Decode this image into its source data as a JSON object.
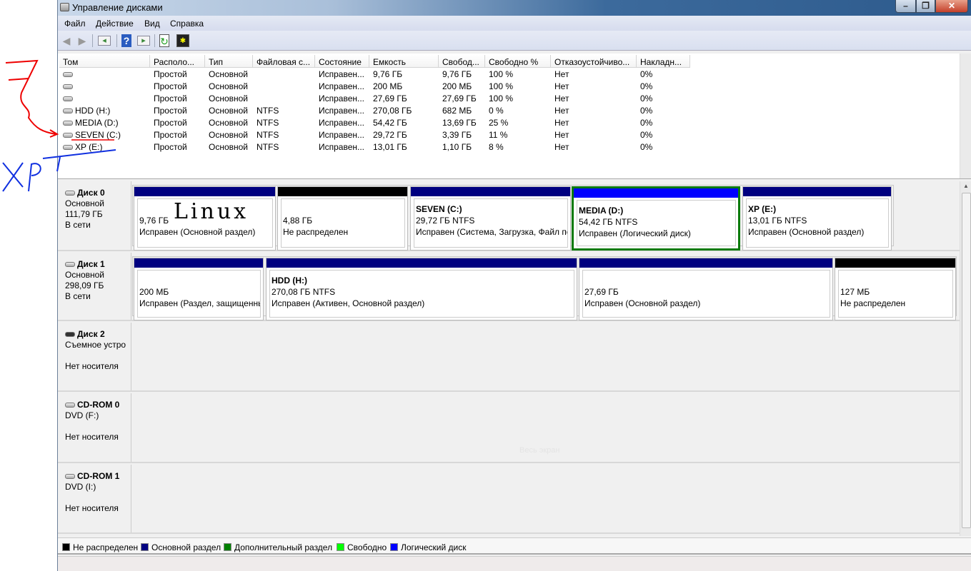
{
  "window": {
    "title": "Управление дисками",
    "minimize": "–",
    "maximize": "❐",
    "close": "✕"
  },
  "menu": [
    "Файл",
    "Действие",
    "Вид",
    "Справка"
  ],
  "toolbar": {
    "icons": [
      "back-arrow-icon",
      "forward-arrow-icon",
      "console-tree-icon",
      "help-icon",
      "action-pane-icon",
      "refresh-icon",
      "properties-icon"
    ]
  },
  "volume_list": {
    "columns": [
      "Том",
      "Располо...",
      "Тип",
      "Файловая с...",
      "Состояние",
      "Емкость",
      "Свобод...",
      "Свободно %",
      "Отказоустойчиво...",
      "Накладн..."
    ],
    "rows": [
      [
        "",
        "Простой",
        "Основной",
        "",
        "Исправен...",
        "9,76 ГБ",
        "9,76 ГБ",
        "100 %",
        "Нет",
        "0%"
      ],
      [
        "",
        "Простой",
        "Основной",
        "",
        "Исправен...",
        "200 МБ",
        "200 МБ",
        "100 %",
        "Нет",
        "0%"
      ],
      [
        "",
        "Простой",
        "Основной",
        "",
        "Исправен...",
        "27,69 ГБ",
        "27,69 ГБ",
        "100 %",
        "Нет",
        "0%"
      ],
      [
        "HDD (H:)",
        "Простой",
        "Основной",
        "NTFS",
        "Исправен...",
        "270,08 ГБ",
        "682 МБ",
        "0 %",
        "Нет",
        "0%"
      ],
      [
        "MEDIA (D:)",
        "Простой",
        "Основной",
        "NTFS",
        "Исправен...",
        "54,42 ГБ",
        "13,69 ГБ",
        "25 %",
        "Нет",
        "0%"
      ],
      [
        "SEVEN (C:)",
        "Простой",
        "Основной",
        "NTFS",
        "Исправен...",
        "29,72 ГБ",
        "3,39 ГБ",
        "11 %",
        "Нет",
        "0%"
      ],
      [
        "XP (E:)",
        "Простой",
        "Основной",
        "NTFS",
        "Исправен...",
        "13,01 ГБ",
        "1,10 ГБ",
        "8 %",
        "Нет",
        "0%"
      ]
    ]
  },
  "disks": [
    {
      "name": "Диск 0",
      "type": "Основной",
      "size": "111,79 ГБ",
      "status": "В сети",
      "partitions": [
        {
          "title": "",
          "size": "9,76 ГБ",
          "status": "Исправен (Основной раздел)",
          "kind": "primary"
        },
        {
          "title": "",
          "size": "4,88 ГБ",
          "status": "Не распределен",
          "kind": "unallocated"
        },
        {
          "title": "SEVEN  (C:)",
          "size": "29,72 ГБ NTFS",
          "status": "Исправен (Система, Загрузка, Файл по",
          "kind": "primary"
        },
        {
          "title": "MEDIA  (D:)",
          "size": "54,42 ГБ NTFS",
          "status": "Исправен (Логический диск)",
          "kind": "logical",
          "selected": true
        },
        {
          "title": "XP  (E:)",
          "size": "13,01 ГБ NTFS",
          "status": "Исправен (Основной раздел)",
          "kind": "primary"
        }
      ]
    },
    {
      "name": "Диск 1",
      "type": "Основной",
      "size": "298,09 ГБ",
      "status": "В сети",
      "partitions": [
        {
          "title": "",
          "size": "200 МБ",
          "status": "Исправен (Раздел, защищенны",
          "kind": "primary"
        },
        {
          "title": "HDD  (H:)",
          "size": "270,08 ГБ NTFS",
          "status": "Исправен (Активен, Основной раздел)",
          "kind": "primary"
        },
        {
          "title": "",
          "size": "27,69 ГБ",
          "status": "Исправен (Основной раздел)",
          "kind": "primary"
        },
        {
          "title": "",
          "size": "127 МБ",
          "status": "Не распределен",
          "kind": "unallocated"
        }
      ]
    },
    {
      "name": "Диск 2",
      "type": "Съемное устро",
      "size": "",
      "status": "Нет носителя",
      "partitions": []
    },
    {
      "name": "CD-ROM 0",
      "type": "DVD (F:)",
      "size": "",
      "status": "Нет носителя",
      "partitions": []
    },
    {
      "name": "CD-ROM 1",
      "type": "DVD (I:)",
      "size": "",
      "status": "Нет носителя",
      "partitions": []
    }
  ],
  "legend": [
    {
      "label": "Не распределен",
      "color": "#000000"
    },
    {
      "label": "Основной раздел",
      "color": "#000080"
    },
    {
      "label": "Дополнительный раздел",
      "color": "#008000"
    },
    {
      "label": "Свободно",
      "color": "#00ff00"
    },
    {
      "label": "Логический диск",
      "color": "#0000ff"
    }
  ],
  "watermark": "Весь экран",
  "annotations": {
    "seven": "7",
    "xp": "XP",
    "linux": "Linux"
  },
  "colors": {
    "primary": "#000080",
    "unallocated": "#000000",
    "logical": "#0000ff",
    "selected_border": "#0a7a0a"
  }
}
